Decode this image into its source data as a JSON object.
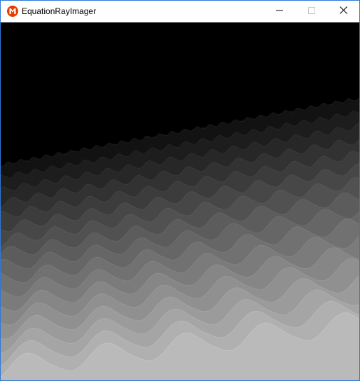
{
  "window": {
    "title": "EquationRayImager",
    "accent_color": "#2b79d8",
    "icon": "monogame-icon",
    "buttons": {
      "minimize": "minimize-icon",
      "maximize": "maximize-icon",
      "close": "close-icon"
    }
  },
  "canvas": {
    "background_color": "#000000",
    "content": "grayscale rendered wave surface"
  }
}
